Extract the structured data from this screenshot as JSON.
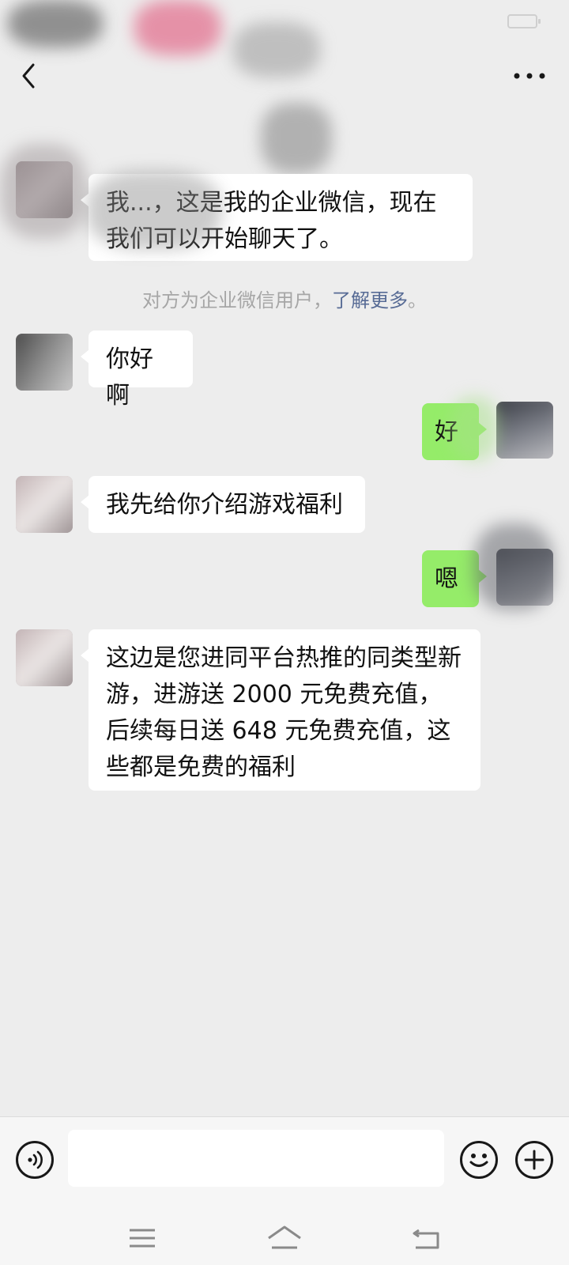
{
  "header": {
    "title": ""
  },
  "messages": [
    {
      "side": "in",
      "text": "我...，这是我的企业微信，现在我们可以开始聊天了。"
    },
    {
      "side": "in",
      "text": "你好啊"
    },
    {
      "side": "out",
      "text": "好"
    },
    {
      "side": "in",
      "text": "我先给你介绍游戏福利"
    },
    {
      "side": "out",
      "text": "嗯"
    },
    {
      "side": "in",
      "text": "这边是您进同平台热推的同类型新游，进游送 2000 元免费充值，后续每日送 648 元免费充值，这些都是免费的福利"
    }
  ],
  "system_note": {
    "text": "对方为企业微信用户，",
    "link": "了解更多",
    "end": "。"
  },
  "input": {
    "placeholder": "",
    "value": ""
  },
  "icons": {
    "back": "chevron-left-icon",
    "more": "more-horizontal-icon",
    "voice": "voice-icon",
    "emoji": "emoji-icon",
    "add": "plus-icon",
    "nav_menu": "menu-icon",
    "nav_home": "home-icon",
    "nav_back": "back-icon"
  },
  "colors": {
    "background": "#ededed",
    "incoming_bubble": "#ffffff",
    "outgoing_bubble": "#95ec69",
    "link": "#576b95",
    "system_text": "#a6a6a6"
  }
}
